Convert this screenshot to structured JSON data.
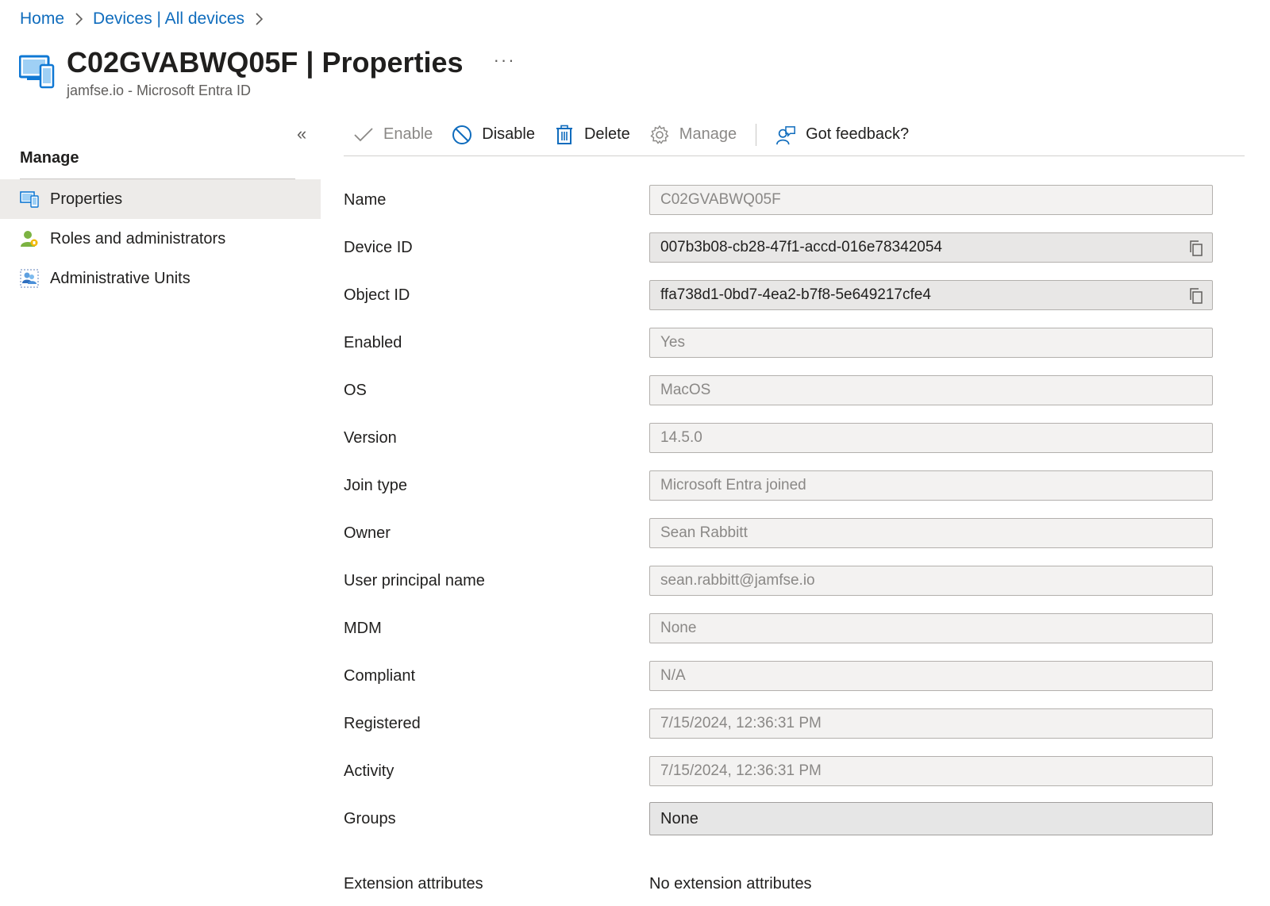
{
  "breadcrumb": {
    "items": [
      "Home",
      "Devices | All devices"
    ]
  },
  "header": {
    "title_bold": "C02GVABWQ05F",
    "title_rest": " | Properties",
    "more": "···",
    "subtitle": "jamfse.io - Microsoft Entra ID"
  },
  "sidenav": {
    "collapse": "«",
    "section": "Manage",
    "items": [
      {
        "label": "Properties",
        "icon": "device-properties-icon",
        "active": true
      },
      {
        "label": "Roles and administrators",
        "icon": "roles-icon"
      },
      {
        "label": "Administrative Units",
        "icon": "admin-units-icon"
      }
    ]
  },
  "toolbar": {
    "enable": "Enable",
    "disable": "Disable",
    "delete": "Delete",
    "manage": "Manage",
    "feedback": "Got feedback?"
  },
  "properties": {
    "name": {
      "label": "Name",
      "value": "C02GVABWQ05F"
    },
    "device_id": {
      "label": "Device ID",
      "value": "007b3b08-cb28-47f1-accd-016e78342054"
    },
    "object_id": {
      "label": "Object ID",
      "value": "ffa738d1-0bd7-4ea2-b7f8-5e649217cfe4"
    },
    "enabled": {
      "label": "Enabled",
      "value": "Yes"
    },
    "os": {
      "label": "OS",
      "value": "MacOS"
    },
    "version": {
      "label": "Version",
      "value": "14.5.0"
    },
    "join_type": {
      "label": "Join type",
      "value": "Microsoft Entra joined"
    },
    "owner": {
      "label": "Owner",
      "value": "Sean Rabbitt"
    },
    "upn": {
      "label": "User principal name",
      "value": "sean.rabbitt@jamfse.io"
    },
    "mdm": {
      "label": "MDM",
      "value": "None"
    },
    "compliant": {
      "label": "Compliant",
      "value": "N/A"
    },
    "registered": {
      "label": "Registered",
      "value": "7/15/2024, 12:36:31 PM"
    },
    "activity": {
      "label": "Activity",
      "value": "7/15/2024, 12:36:31 PM"
    },
    "groups": {
      "label": "Groups",
      "value": "None"
    },
    "extension": {
      "label": "Extension attributes",
      "value": "No extension attributes"
    }
  },
  "colors": {
    "link": "#0f6cbd",
    "active_nav": "#edebe9",
    "field_bg": "#f3f2f1"
  }
}
